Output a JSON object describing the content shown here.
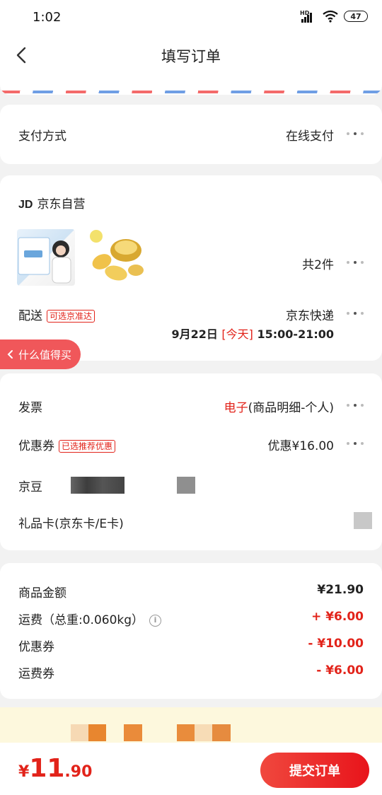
{
  "status_bar": {
    "time": "1:02",
    "hd_label": "HD",
    "battery": "47"
  },
  "nav": {
    "title": "填写订单"
  },
  "payment": {
    "label": "支付方式",
    "value": "在线支付"
  },
  "shop": {
    "logo": "JD",
    "name": "京东自营",
    "item_count": "共2件",
    "delivery_label": "配送",
    "delivery_tag": "可选京准达",
    "delivery_company": "京东快递",
    "delivery_date": "9月22日",
    "delivery_today": "[今天]",
    "delivery_time": "15:00-21:00"
  },
  "worth_buy": {
    "label": "什么值得买"
  },
  "invoice": {
    "label": "发票",
    "value_highlight": "电子",
    "value_rest": "(商品明细-个人)"
  },
  "coupon": {
    "label": "优惠券",
    "tag": "已选推荐优惠",
    "value": "优惠¥16.00"
  },
  "jingdou": {
    "label": "京豆"
  },
  "gift_card": {
    "label": "礼品卡(京东卡/E卡)"
  },
  "summary": {
    "rows": [
      {
        "label": "商品金额",
        "value": "¥21.90"
      },
      {
        "label": "运费（总重:0.060kg）",
        "value": "+ ¥6.00"
      },
      {
        "label": "优惠券",
        "value": "- ¥10.00"
      },
      {
        "label": "运费券",
        "value": "- ¥6.00"
      }
    ]
  },
  "bottom": {
    "currency": "¥",
    "price_int": "11",
    "price_dec": ".90",
    "submit_label": "提交订单"
  },
  "colors": {
    "accent": "#e2231a",
    "background": "#f2f2f2",
    "promo_bg": "#fdf8dd"
  }
}
